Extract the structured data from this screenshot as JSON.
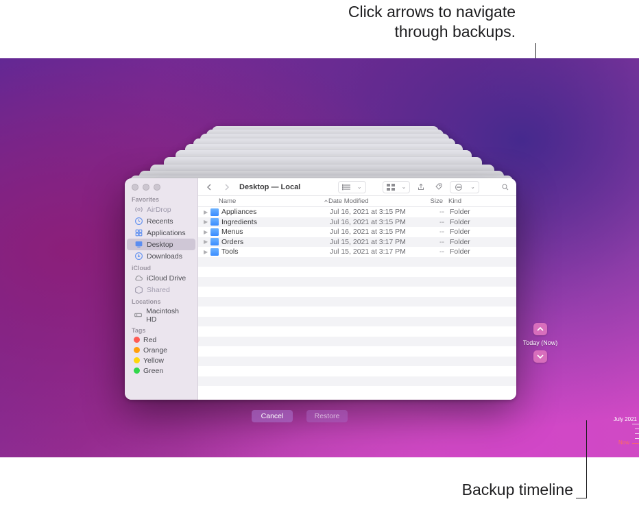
{
  "annotations": {
    "top": "Click arrows to navigate\nthrough backups.",
    "bottom": "Backup timeline"
  },
  "nav": {
    "current_label": "Today (Now)"
  },
  "finder": {
    "title": "Desktop — Local",
    "sidebar": {
      "favorites_header": "Favorites",
      "icloud_header": "iCloud",
      "locations_header": "Locations",
      "tags_header": "Tags",
      "items": {
        "airdrop": "AirDrop",
        "recents": "Recents",
        "applications": "Applications",
        "desktop": "Desktop",
        "downloads": "Downloads",
        "icloud_drive": "iCloud Drive",
        "shared": "Shared",
        "mac_hd": "Macintosh HD"
      },
      "tags": [
        {
          "name": "Red",
          "color": "#ff5b53"
        },
        {
          "name": "Orange",
          "color": "#ff9f0a"
        },
        {
          "name": "Yellow",
          "color": "#ffd60a"
        },
        {
          "name": "Green",
          "color": "#32d74b"
        }
      ]
    },
    "columns": {
      "name": "Name",
      "date": "Date Modified",
      "size": "Size",
      "kind": "Kind"
    },
    "files": [
      {
        "name": "Appliances",
        "date": "Jul 16, 2021 at 3:15 PM",
        "size": "--",
        "kind": "Folder"
      },
      {
        "name": "Ingredients",
        "date": "Jul 16, 2021 at 3:15 PM",
        "size": "--",
        "kind": "Folder"
      },
      {
        "name": "Menus",
        "date": "Jul 16, 2021 at 3:15 PM",
        "size": "--",
        "kind": "Folder"
      },
      {
        "name": "Orders",
        "date": "Jul 15, 2021 at 3:17 PM",
        "size": "--",
        "kind": "Folder"
      },
      {
        "name": "Tools",
        "date": "Jul 15, 2021 at 3:17 PM",
        "size": "--",
        "kind": "Folder"
      }
    ]
  },
  "actions": {
    "cancel": "Cancel",
    "restore": "Restore"
  },
  "timeline": {
    "month": "July 2021",
    "now": "Now"
  }
}
